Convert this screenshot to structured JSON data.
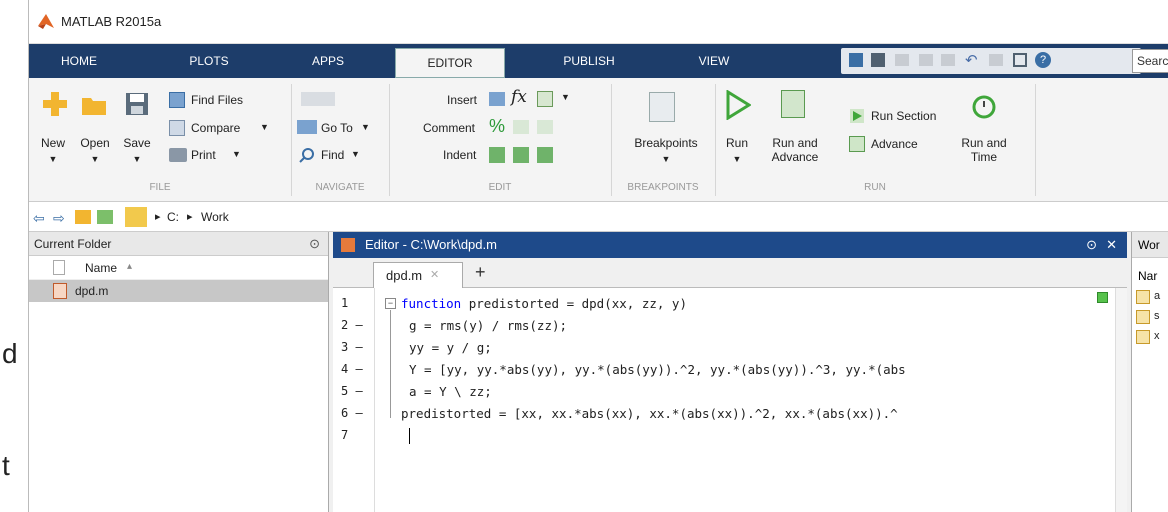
{
  "outer_text": [
    "d",
    "t"
  ],
  "window": {
    "title": "MATLAB R2015a"
  },
  "tabs": [
    "HOME",
    "PLOTS",
    "APPS",
    "EDITOR",
    "PUBLISH",
    "VIEW"
  ],
  "search": {
    "placeholder": "Searc"
  },
  "ribbon": {
    "file": {
      "new": "New",
      "open": "Open",
      "save": "Save",
      "find_files": "Find Files",
      "compare": "Compare",
      "print": "Print",
      "group": "FILE"
    },
    "navigate": {
      "go_to": "Go To",
      "find": "Find",
      "group": "NAVIGATE"
    },
    "edit": {
      "insert": "Insert",
      "comment": "Comment",
      "indent": "Indent",
      "group": "EDIT"
    },
    "breakpoints": {
      "breakpoints": "Breakpoints",
      "group": "BREAKPOINTS"
    },
    "run": {
      "run": "Run",
      "run_and_advance": "Run and Advance",
      "run_section": "Run Section",
      "advance": "Advance",
      "run_and_time": "Run and Time",
      "group": "RUN"
    }
  },
  "address": {
    "path": [
      "C:",
      "Work"
    ]
  },
  "current_folder": {
    "title": "Current Folder",
    "column": "Name",
    "sort_indicator": "▴",
    "files": [
      "dpd.m"
    ]
  },
  "editor": {
    "title": "Editor - C:\\Work\\dpd.m",
    "tab": "dpd.m",
    "tab_close": "✕",
    "add_tab": "+",
    "line_numbers": [
      "1",
      "2 –",
      "3 –",
      "4 –",
      "5 –",
      "6 –",
      "7"
    ],
    "lines": [
      {
        "kw": "function",
        "text": " predistorted = dpd(xx, zz, y)"
      },
      {
        "kw": "",
        "text": "g = rms(y) / rms(zz);"
      },
      {
        "kw": "",
        "text": "yy = y / g;"
      },
      {
        "kw": "",
        "text": "Y = [yy, yy.*abs(yy), yy.*(abs(yy)).^2, yy.*(abs(yy)).^3, yy.*(abs"
      },
      {
        "kw": "",
        "text": "a = Y \\ zz;"
      },
      {
        "kw": "",
        "text": "predistorted = [xx, xx.*abs(xx), xx.*(abs(xx)).^2, xx.*(abs(xx)).^"
      },
      {
        "kw": "",
        "text": ""
      }
    ]
  },
  "workspace": {
    "title": "Wor",
    "column": "Nar",
    "items": [
      "a",
      "s",
      "x"
    ]
  },
  "colors": {
    "tabbar": "#1d3d6a",
    "editor_header": "#1e4a8a",
    "keyword": "#0000ff"
  }
}
